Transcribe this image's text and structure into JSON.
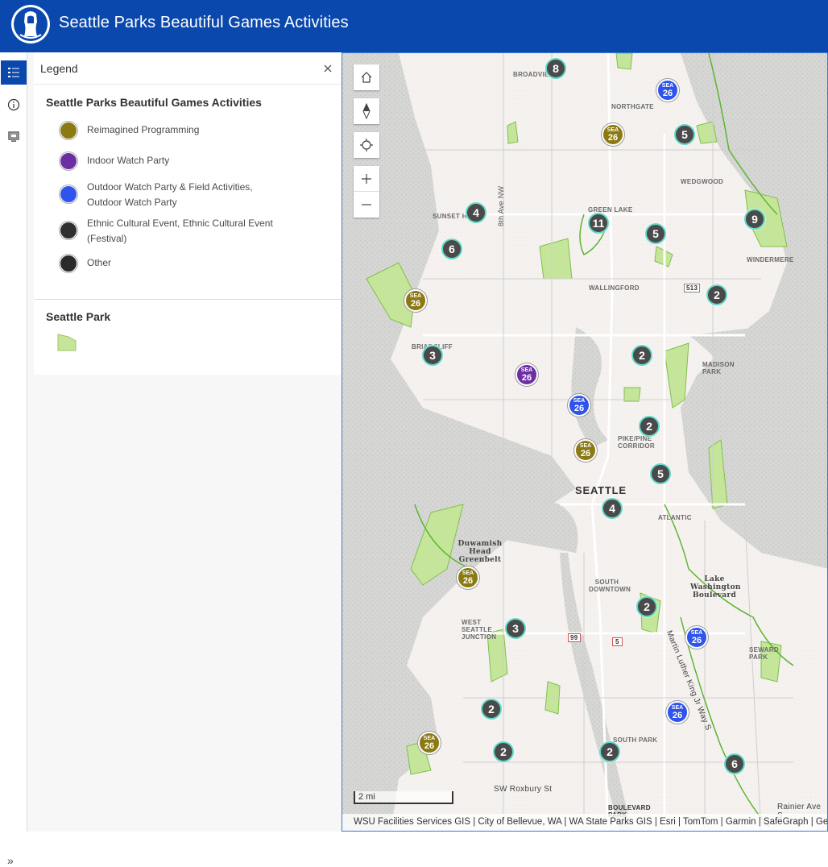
{
  "header": {
    "title": "Seattle Parks Beautiful Games Activities"
  },
  "panel": {
    "title": "Legend",
    "layer_title": "Seattle Parks Beautiful Games Activities",
    "legend": [
      {
        "label": "Reimagined Programming",
        "color": "#8b7a12",
        "numcolor": "#fff"
      },
      {
        "label": "Indoor Watch Party",
        "color": "#6b2fa3",
        "numcolor": "#fff"
      },
      {
        "label": "Outdoor Watch Party & Field Activities, Outdoor Watch Party",
        "color": "#2f54eb",
        "numcolor": "#fff"
      },
      {
        "label": "Ethnic Cultural Event, Ethnic Cultural Event (Festival)",
        "color": "#303030",
        "numcolor": "#fff"
      },
      {
        "label": "Other",
        "color": "#2a2a2a",
        "numcolor": "#3be0b0"
      }
    ],
    "park_layer_title": "Seattle Park",
    "park_color": "#c5e69a"
  },
  "pin_text": {
    "top": "SEA",
    "bottom": "26"
  },
  "map": {
    "places": {
      "broadview": "BROADVIEW",
      "northgate": "NORTHGATE",
      "wedgwood": "WEDGWOOD",
      "green_lake": "GREEN LAKE",
      "sunset_hill": "SUNSET HILL",
      "eighth_ave": "8th Ave NW",
      "windermere": "WINDERMERE",
      "wallingford": "WALLINGFORD",
      "briarcliff": "BRIARCLIFF",
      "madison_park": "MADISON PARK",
      "pike_pine": "PIKE/PINE CORRIDOR",
      "seattle": "SEATTLE",
      "atlantic": "ATLANTIC",
      "duwamish": "Duwamish Head Greenbelt",
      "lake_wash": "Lake Washington Boulevard",
      "south_downtown": "SOUTH DOWNTOWN",
      "west_seattle": "WEST SEATTLE JUNCTION",
      "seward_park": "SEWARD PARK",
      "mlk": "Martin Luther King Jr Way S",
      "south_park": "SOUTH PARK",
      "roxbury": "SW Roxbury St",
      "boulevard_park": "BOULEVARD PARK",
      "rainier": "Rainier Ave S",
      "hwy99": "99",
      "hwy5": "5",
      "hwy513": "513"
    },
    "clusters": [
      "8",
      "5",
      "4",
      "11",
      "5",
      "9",
      "6",
      "2",
      "3",
      "2",
      "2",
      "5",
      "4",
      "2",
      "3",
      "2",
      "2",
      "2",
      "6"
    ],
    "scale": "2 mi",
    "attribution": "WSU Facilities Services GIS | City of Bellevue, WA | WA State Parks GIS | Esri | TomTom | Garmin | SafeGraph | GeoTechnologies, Inc"
  }
}
